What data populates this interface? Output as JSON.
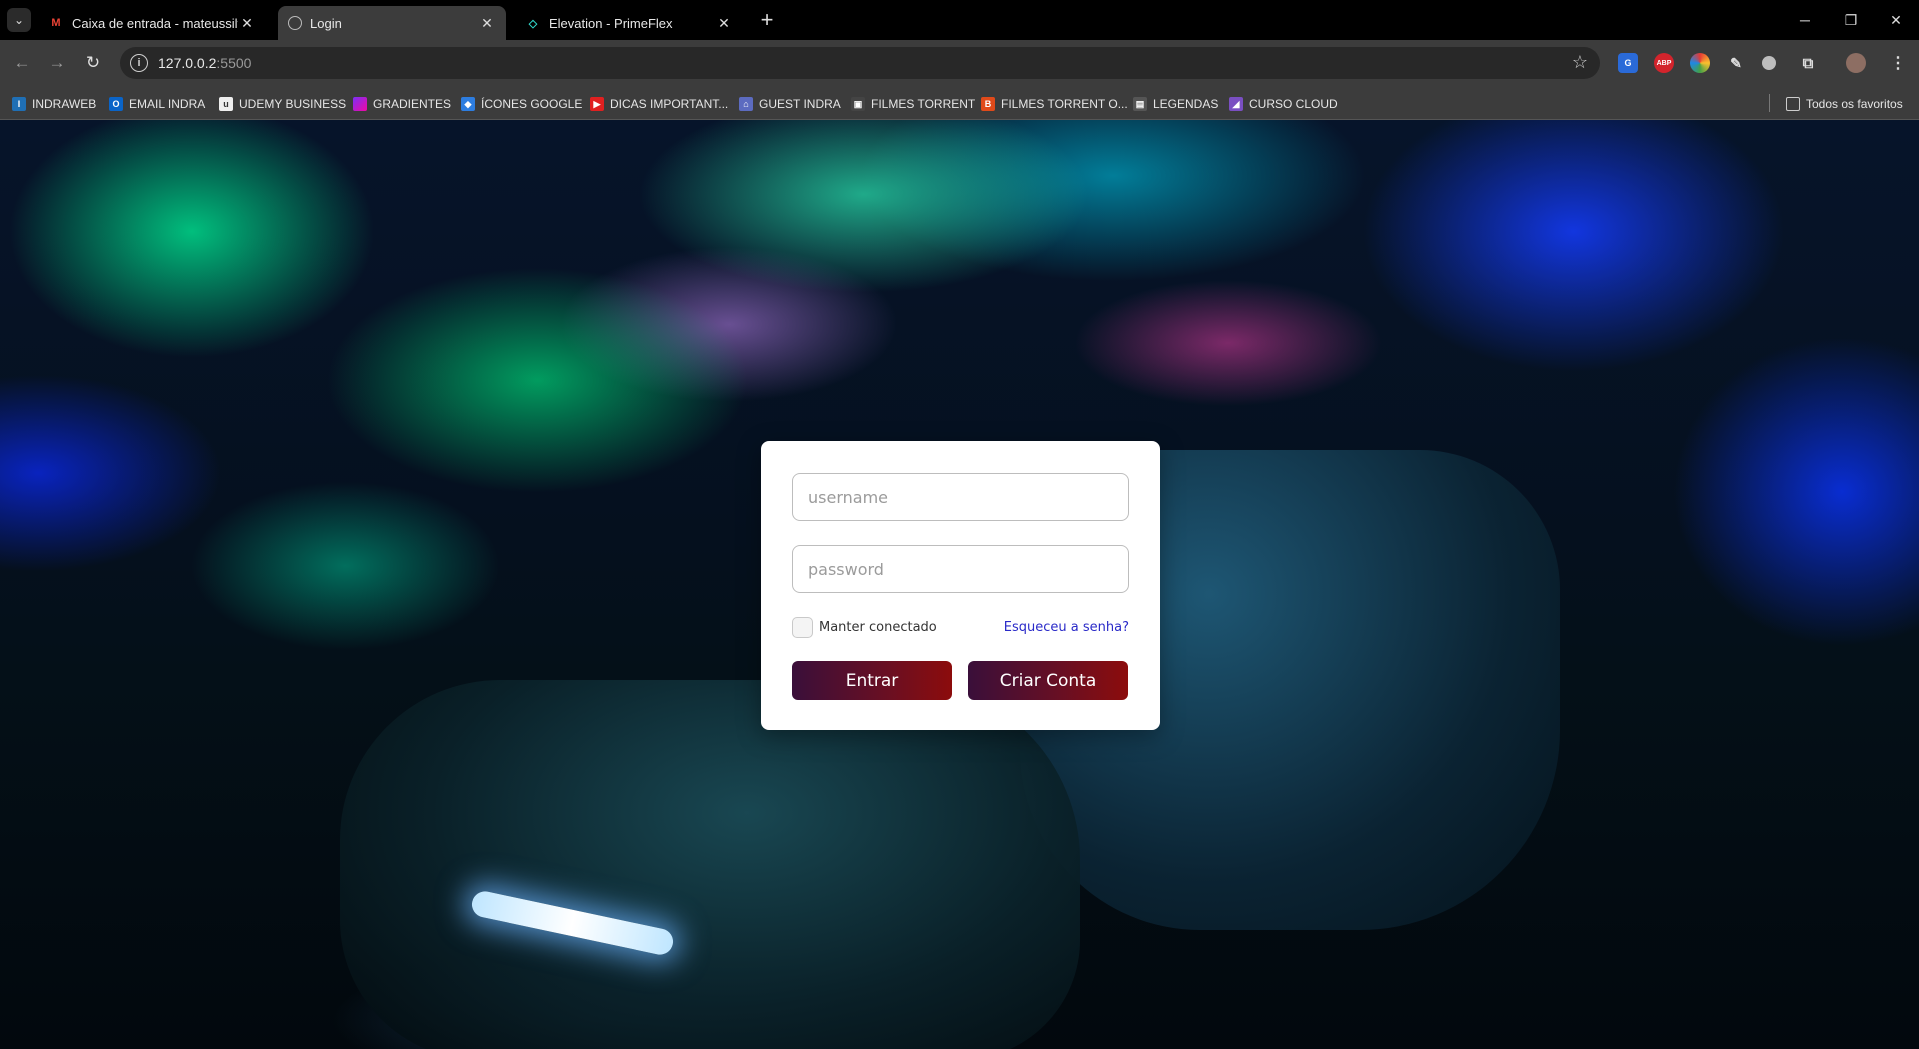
{
  "browser": {
    "tabs": [
      {
        "title": "Caixa de entrada - mateussilva",
        "favicon": "gmail-icon"
      },
      {
        "title": "Login",
        "favicon": "globe-icon",
        "active": true
      },
      {
        "title": "Elevation - PrimeFlex",
        "favicon": "primeflex-icon"
      }
    ],
    "new_tab": "+",
    "window_controls": {
      "minimize": "─",
      "restore": "❐",
      "close": "✕"
    },
    "address": {
      "host": "127.0.0.2",
      "port": ":5500"
    },
    "bookmarks": [
      {
        "label": "INDRAWEB",
        "color": "#1f6fb5",
        "glyph": "I"
      },
      {
        "label": "EMAIL INDRA",
        "color": "#0a64c8",
        "glyph": "O"
      },
      {
        "label": "UDEMY BUSINESS",
        "color": "#333333",
        "glyph": "u"
      },
      {
        "label": "GRADIENTES",
        "color": "#c2386e",
        "glyph": ""
      },
      {
        "label": "ÍCONES GOOGLE",
        "color": "#2d7de0",
        "glyph": "◆"
      },
      {
        "label": "DICAS IMPORTANT...",
        "color": "#e02020",
        "glyph": "▶"
      },
      {
        "label": "GUEST INDRA",
        "color": "#5c6bc0",
        "glyph": "⌂"
      },
      {
        "label": "FILMES TORRENT",
        "color": "#444444",
        "glyph": "▣"
      },
      {
        "label": "FILMES TORRENT O...",
        "color": "#e04a1a",
        "glyph": "B"
      },
      {
        "label": "LEGENDAS",
        "color": "#555555",
        "glyph": "▤"
      },
      {
        "label": "CURSO CLOUD",
        "color": "#7a4fc2",
        "glyph": "◢"
      }
    ],
    "all_bookmarks": "Todos os favoritos"
  },
  "login": {
    "username_placeholder": "username",
    "password_placeholder": "password",
    "remember_label": "Manter conectado",
    "forgot_link": "Esqueceu a senha?",
    "login_button": "Entrar",
    "signup_button": "Criar Conta"
  },
  "colors": {
    "button_gradient_start": "#3a0f3a",
    "button_gradient_end": "#8c0c0c",
    "link": "#2a2ac8"
  }
}
